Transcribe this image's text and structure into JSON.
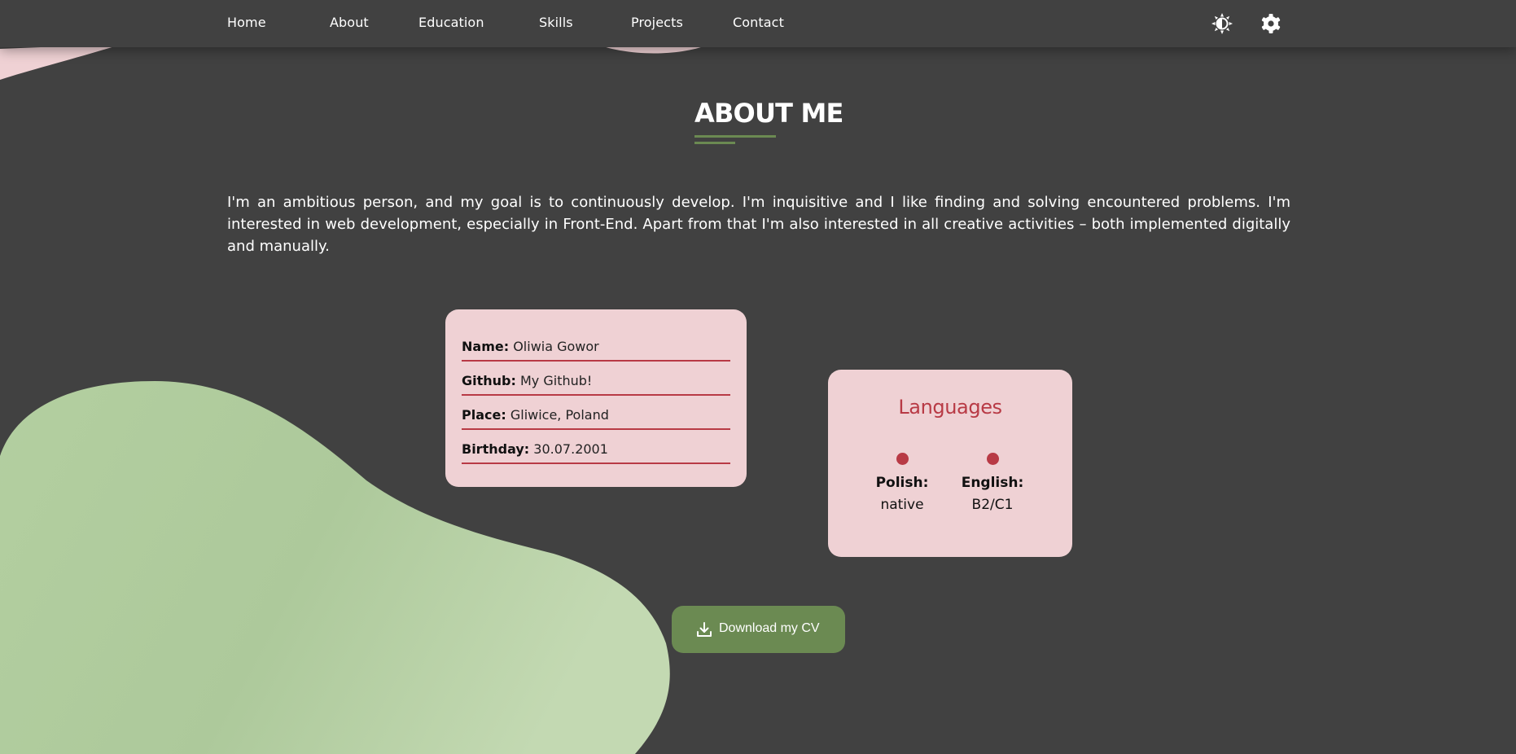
{
  "nav": {
    "items": [
      {
        "label": "Home"
      },
      {
        "label": "About"
      },
      {
        "label": "Education"
      },
      {
        "label": "Skills"
      },
      {
        "label": "Projects"
      },
      {
        "label": "Contact"
      }
    ],
    "icons": [
      "theme-toggle-icon",
      "settings-gear-icon"
    ]
  },
  "about": {
    "title": "ABOUT ME",
    "intro": "I'm an ambitious person, and my goal is to continuously develop. I'm inquisitive and I like finding and solving encountered problems. I'm interested in web development, especially in Front-End. Apart from that I'm also interested in all creative activities – both implemented digitally and manually."
  },
  "info": {
    "name_label": "Name:",
    "name_value": "Oliwia Gowor",
    "github_label": "Github:",
    "github_value": "My Github!",
    "place_label": "Place:",
    "place_value": "Gliwice, Poland",
    "birthday_label": "Birthday:",
    "birthday_value": "30.07.2001"
  },
  "languages": {
    "title": "Languages",
    "items": [
      {
        "name": "Polish:",
        "level": "native"
      },
      {
        "name": "English:",
        "level": "B2/C1"
      }
    ]
  },
  "cv_button": {
    "label": "Download my CV",
    "icon": "download-icon"
  },
  "colors": {
    "background": "#414141",
    "accent_green": "#6b8a52",
    "card_pink": "#efd1d4",
    "accent_red": "#b83a45",
    "blob_green": "#b2cc9e"
  }
}
